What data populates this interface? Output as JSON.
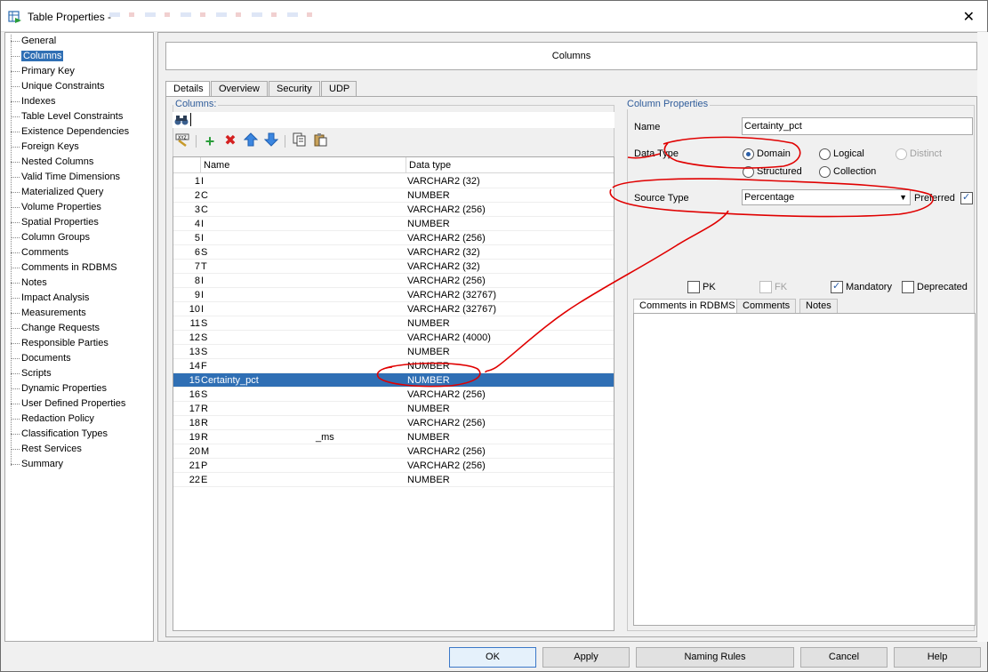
{
  "window": {
    "title": "Table Properties -",
    "close_glyph": "✕"
  },
  "nav": {
    "items": [
      "General",
      "Columns",
      "Primary Key",
      "Unique Constraints",
      "Indexes",
      "Table Level Constraints",
      "Existence Dependencies",
      "Foreign Keys",
      "Nested Columns",
      "Valid Time Dimensions",
      "Materialized Query",
      "Volume Properties",
      "Spatial Properties",
      "Column Groups",
      "Comments",
      "Comments in RDBMS",
      "Notes",
      "Impact Analysis",
      "Measurements",
      "Change Requests",
      "Responsible Parties",
      "Documents",
      "Scripts",
      "Dynamic Properties",
      "User Defined Properties",
      "Redaction Policy",
      "Classification Types",
      "Rest Services",
      "Summary"
    ],
    "selected": "Columns"
  },
  "header": {
    "title": "Columns"
  },
  "tabs": [
    "Details",
    "Overview",
    "Security",
    "UDP"
  ],
  "columns_panel": {
    "label": "Columns:",
    "search_value": "",
    "headers": {
      "name": "Name",
      "type": "Data type"
    },
    "rows": [
      {
        "num": "1",
        "name": "I",
        "type": "VARCHAR2 (32)"
      },
      {
        "num": "2",
        "name": "C",
        "type": "NUMBER"
      },
      {
        "num": "3",
        "name": "C",
        "type": "VARCHAR2 (256)"
      },
      {
        "num": "4",
        "name": "I",
        "type": "NUMBER"
      },
      {
        "num": "5",
        "name": "I",
        "type": "VARCHAR2 (256)"
      },
      {
        "num": "6",
        "name": "S",
        "type": "VARCHAR2 (32)"
      },
      {
        "num": "7",
        "name": "T",
        "type": "VARCHAR2 (32)"
      },
      {
        "num": "8",
        "name": "I",
        "type": "VARCHAR2 (256)"
      },
      {
        "num": "9",
        "name": "I",
        "type": "VARCHAR2 (32767)"
      },
      {
        "num": "10",
        "name": "I",
        "type": "VARCHAR2 (32767)"
      },
      {
        "num": "11",
        "name": "S",
        "type": "NUMBER"
      },
      {
        "num": "12",
        "name": "S",
        "type": "VARCHAR2 (4000)"
      },
      {
        "num": "13",
        "name": "S",
        "type": "NUMBER"
      },
      {
        "num": "14",
        "name": "F",
        "type": "NUMBER"
      },
      {
        "num": "15",
        "name": "Certainty_pct",
        "type": "NUMBER"
      },
      {
        "num": "16",
        "name": "S",
        "type": "VARCHAR2 (256)"
      },
      {
        "num": "17",
        "name": "R",
        "type": "NUMBER"
      },
      {
        "num": "18",
        "name": "R",
        "type": "VARCHAR2 (256)"
      },
      {
        "num": "19",
        "name": "R",
        "type": "NUMBER"
      },
      {
        "num": "20",
        "name": "M",
        "type": "VARCHAR2 (256)"
      },
      {
        "num": "21",
        "name": "P",
        "type": "VARCHAR2 (256)"
      },
      {
        "num": "22",
        "name": "E",
        "type": "NUMBER"
      }
    ],
    "row19_suffix": "_ms",
    "selected_row": "15"
  },
  "props": {
    "group_label": "Column Properties",
    "name_label": "Name",
    "name_value": "Certainty_pct",
    "data_type_label": "Data Type",
    "radio_domain": "Domain",
    "radio_logical": "Logical",
    "radio_distinct": "Distinct",
    "radio_structured": "Structured",
    "radio_collection": "Collection",
    "source_type_label": "Source Type",
    "source_type_value": "Percentage",
    "preferred_label": "Preferred",
    "pk_label": "PK",
    "fk_label": "FK",
    "mandatory_label": "Mandatory",
    "deprecated_label": "Deprecated",
    "subtabs": [
      "Comments in RDBMS",
      "Comments",
      "Notes"
    ]
  },
  "buttons": {
    "ok": "OK",
    "apply": "Apply",
    "naming_rules": "Naming Rules",
    "cancel": "Cancel",
    "help": "Help"
  },
  "colors": {
    "selection": "#2f6fb4",
    "annotation": "#e00000",
    "group_label": "#2f5c9a"
  }
}
